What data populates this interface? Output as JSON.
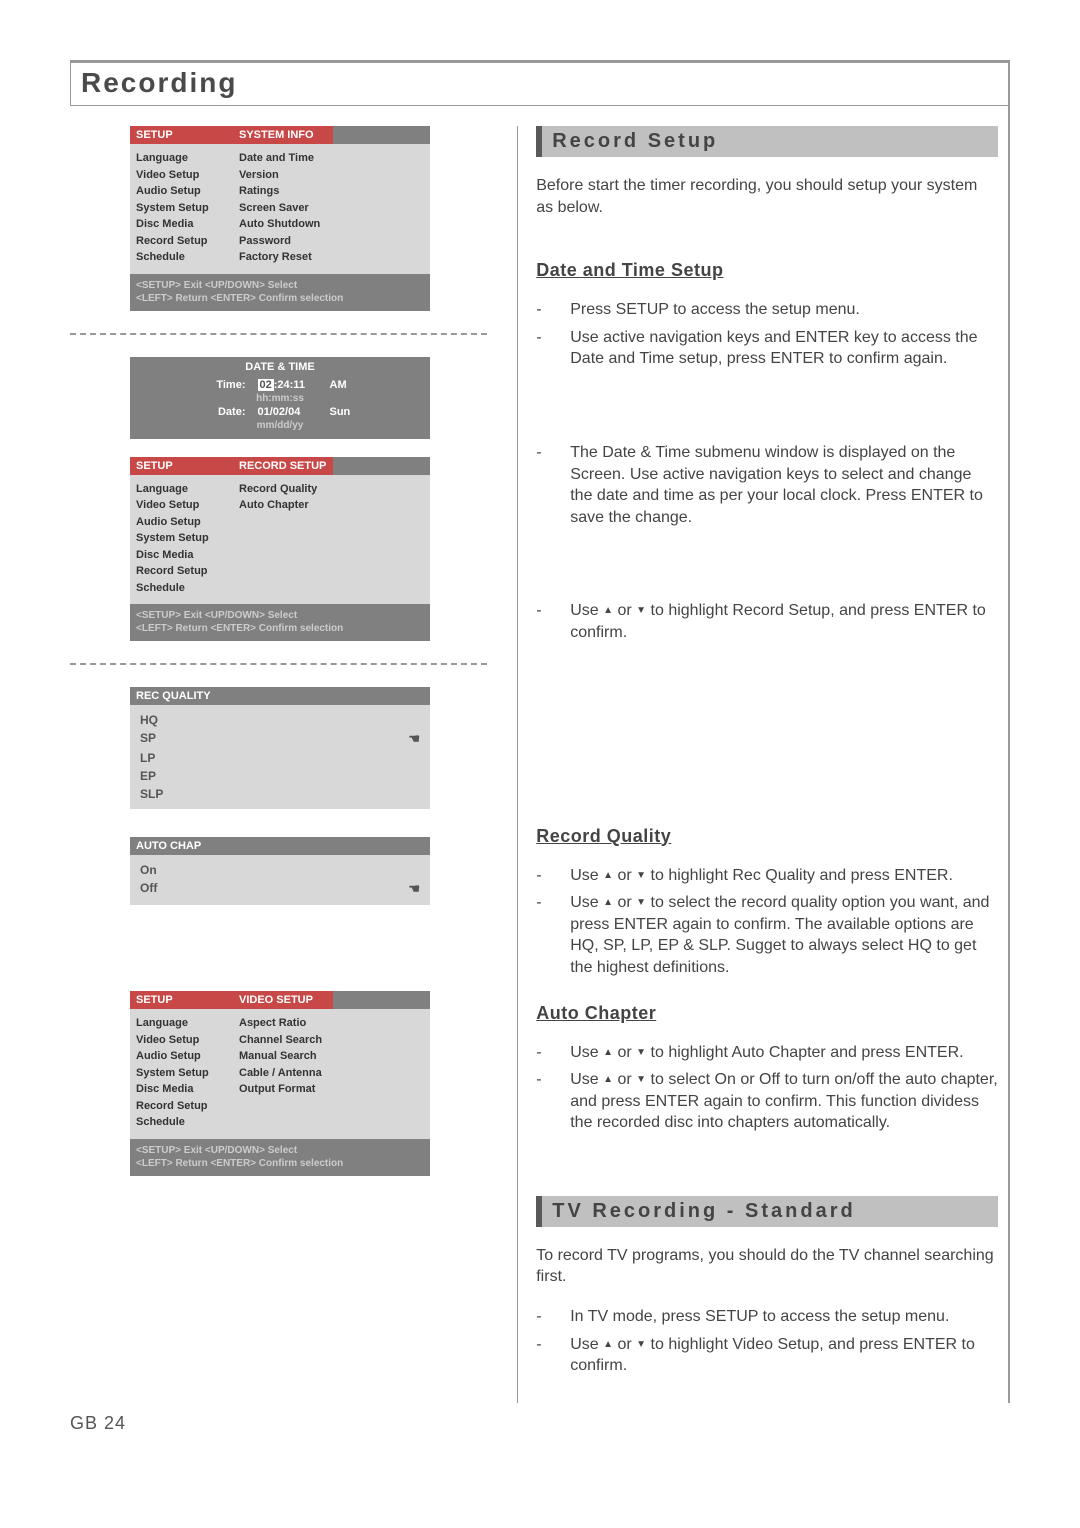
{
  "page_title": "Recording",
  "page_number": "GB 24",
  "setup_menu": {
    "left_header": "SETUP",
    "left_items": [
      "Language",
      "Video Setup",
      "Audio Setup",
      "System Setup",
      "Disc Media",
      "Record Setup",
      "Schedule"
    ],
    "footer_line1": "<SETUP> Exit   <UP/DOWN> Select",
    "footer_line2": "<LEFT> Return  <ENTER> Confirm selection"
  },
  "system_info_menu": {
    "right_header": "SYSTEM INFO",
    "right_items": [
      "Date and Time",
      "Version",
      "Ratings",
      "Screen Saver",
      "Auto Shutdown",
      "Password",
      "Factory Reset"
    ]
  },
  "datetime_box": {
    "header": "DATE & TIME",
    "time_label": "Time:",
    "time_value_hl": "02",
    "time_value_rest": ":24:11",
    "time_ampm": "AM",
    "time_fmt": "hh:mm:ss",
    "date_label": "Date:",
    "date_value": "01/02/04",
    "date_day": "Sun",
    "date_fmt": "mm/dd/yy"
  },
  "record_setup_menu": {
    "right_header": "RECORD SETUP",
    "right_items": [
      "Record Quality",
      "Auto Chapter"
    ]
  },
  "rec_quality_box": {
    "header": "REC QUALITY",
    "items": [
      "HQ",
      "SP",
      "LP",
      "EP",
      "SLP"
    ],
    "selected": "SP"
  },
  "auto_chap_box": {
    "header": "AUTO CHAP",
    "items": [
      "On",
      "Off"
    ],
    "selected": "Off"
  },
  "video_setup_menu": {
    "right_header": "VIDEO SETUP",
    "right_items": [
      "Aspect Ratio",
      "Channel Search",
      "Manual Search",
      "Cable / Antenna",
      "Output Format"
    ]
  },
  "right": {
    "record_setup": {
      "heading": "Record Setup",
      "intro": "Before start the timer recording, you should setup your system as below."
    },
    "date_time": {
      "heading": "Date and Time Setup",
      "b1": "Press SETUP to access the setup menu.",
      "b2": "Use active navigation keys and ENTER key to access the Date and Time setup, press ENTER to confirm again.",
      "b3": "The Date & Time submenu window is displayed on the Screen. Use active navigation keys to select and change the date and time as per your local clock. Press ENTER to save the change.",
      "b4_pre": "Use ",
      "b4_mid": " or ",
      "b4_post": " to highlight Record Setup, and press ENTER to confirm."
    },
    "record_quality": {
      "heading": "Record Quality",
      "b1_pre": "Use ",
      "b1_mid": " or ",
      "b1_post": " to highlight Rec Quality and press ENTER.",
      "b2_pre": "Use ",
      "b2_mid": " or ",
      "b2_post": " to select the record quality option you want, and press ENTER again to confirm. The available options are HQ, SP, LP, EP & SLP. Sugget to always select HQ to get the highest definitions."
    },
    "auto_chapter": {
      "heading": "Auto Chapter",
      "b1_pre": "Use ",
      "b1_mid": " or ",
      "b1_post": " to highlight Auto Chapter and press ENTER.",
      "b2_pre": "Use ",
      "b2_mid": " or ",
      "b2_post": " to select On or Off to turn on/off the auto chapter, and press ENTER again to confirm. This function dividess the recorded disc into chapters automatically."
    },
    "tv_recording": {
      "heading": "TV Recording - Standard",
      "intro": "To record TV programs, you should do the TV channel searching first.",
      "b1": "In TV mode, press SETUP to access the setup menu.",
      "b2_pre": "Use ",
      "b2_mid": " or ",
      "b2_post": " to highlight Video Setup, and press ENTER to confirm."
    }
  }
}
